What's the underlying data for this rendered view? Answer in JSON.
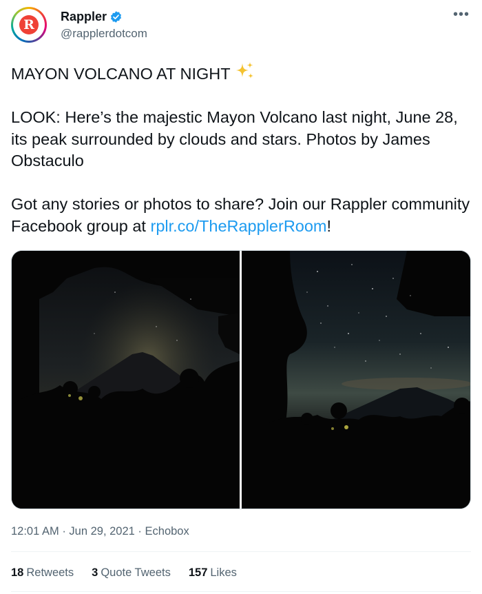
{
  "account": {
    "display_name": "Rappler",
    "handle": "@rapplerdotcom",
    "avatar_letter": "R",
    "verified": true,
    "brand_color": "#ef4136",
    "verified_color": "#1d9bf0"
  },
  "tweet": {
    "title_line": "MAYON VOLCANO AT NIGHT",
    "title_emoji_icon": "sparkles-icon",
    "paragraph1": "LOOK: Here’s the majestic Mayon Volcano last night, June 28, its peak surrounded by clouds and stars. Photos by James Obstaculo",
    "paragraph2_before_link": "Got any stories or photos to share? Join our Rappler community Facebook group at ",
    "paragraph2_link": "rplr.co/TheRapplerRoom",
    "paragraph2_after_link": "!"
  },
  "meta": {
    "time": "12:01 AM",
    "date": "Jun 29, 2021",
    "separator": "·",
    "source": "Echobox"
  },
  "stats": {
    "retweets_count": "18",
    "retweets_label": "Retweets",
    "quotes_count": "3",
    "quotes_label": "Quote Tweets",
    "likes_count": "157",
    "likes_label": "Likes"
  },
  "colors": {
    "text": "#0f1419",
    "secondary": "#536471",
    "link": "#1d9bf0"
  }
}
